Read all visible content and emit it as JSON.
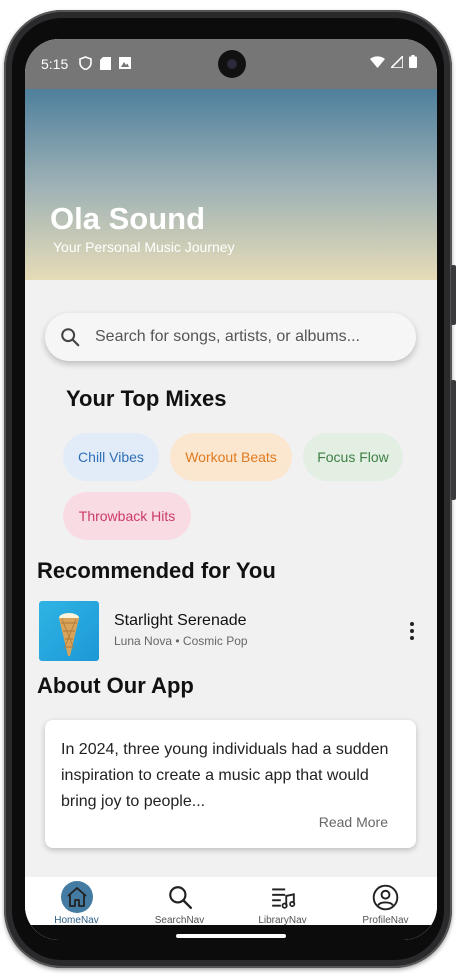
{
  "status_bar": {
    "time": "5:15"
  },
  "header": {
    "title": "Ola Sound",
    "subtitle": "Your Personal Music Journey"
  },
  "search": {
    "placeholder": "Search for songs, artists, or albums..."
  },
  "top_mixes": {
    "title": "Your Top Mixes",
    "chips": [
      {
        "label": "Chill Vibes",
        "bg": "#e2ecf8",
        "color": "#2f6fb8"
      },
      {
        "label": "Workout Beats",
        "bg": "#fbe6cf",
        "color": "#e07a1f"
      },
      {
        "label": "Focus Flow",
        "bg": "#e3efe3",
        "color": "#3d7f45"
      },
      {
        "label": "Throwback Hits",
        "bg": "#f9dbe3",
        "color": "#cc3a6a"
      }
    ]
  },
  "recommended": {
    "title": "Recommended for You",
    "items": [
      {
        "title": "Starlight Serenade",
        "meta": "Luna Nova • Cosmic Pop"
      }
    ]
  },
  "about": {
    "title": "About Our App",
    "text": "In 2024, three young individuals had a sudden inspiration to create a music app that would bring joy to people...",
    "read_more": "Read More"
  },
  "bottom_nav": {
    "items": [
      {
        "label": "HomeNav",
        "icon": "home-icon",
        "active": true
      },
      {
        "label": "SearchNav",
        "icon": "search-icon",
        "active": false
      },
      {
        "label": "LibraryNav",
        "icon": "library-icon",
        "active": false
      },
      {
        "label": "ProfileNav",
        "icon": "profile-icon",
        "active": false
      }
    ]
  },
  "colors": {
    "accent": "#447ba2",
    "header_top": "#4e7f9c",
    "header_bottom": "#e6dcb7"
  }
}
